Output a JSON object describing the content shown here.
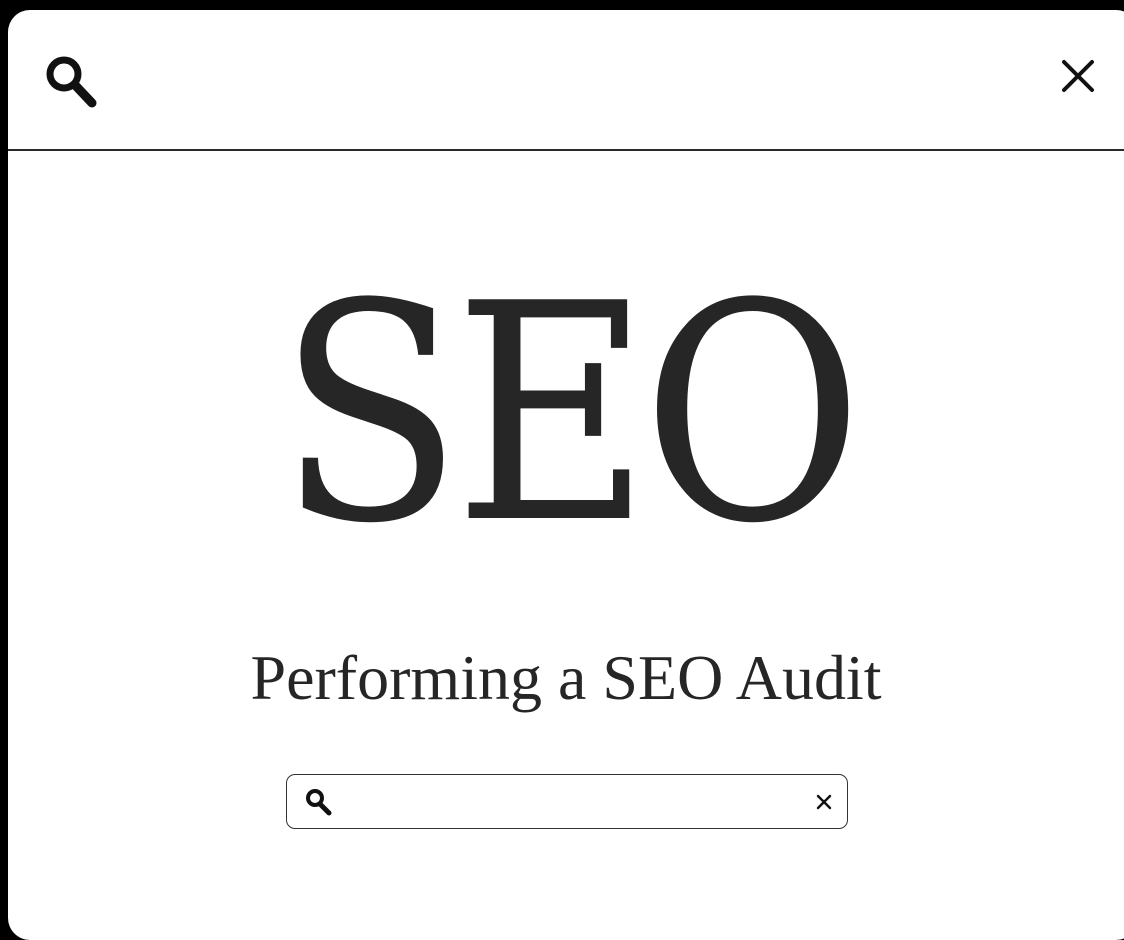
{
  "hero": {
    "title": "SEO",
    "subtitle": "Performing a SEO Audit"
  },
  "search": {
    "value": "",
    "placeholder": ""
  },
  "icons": {
    "top_search": "search-icon",
    "top_close": "close-icon",
    "field_search": "search-icon",
    "field_clear": "close-icon"
  },
  "colors": {
    "background": "#000000",
    "panel": "#ffffff",
    "text": "#262626"
  }
}
